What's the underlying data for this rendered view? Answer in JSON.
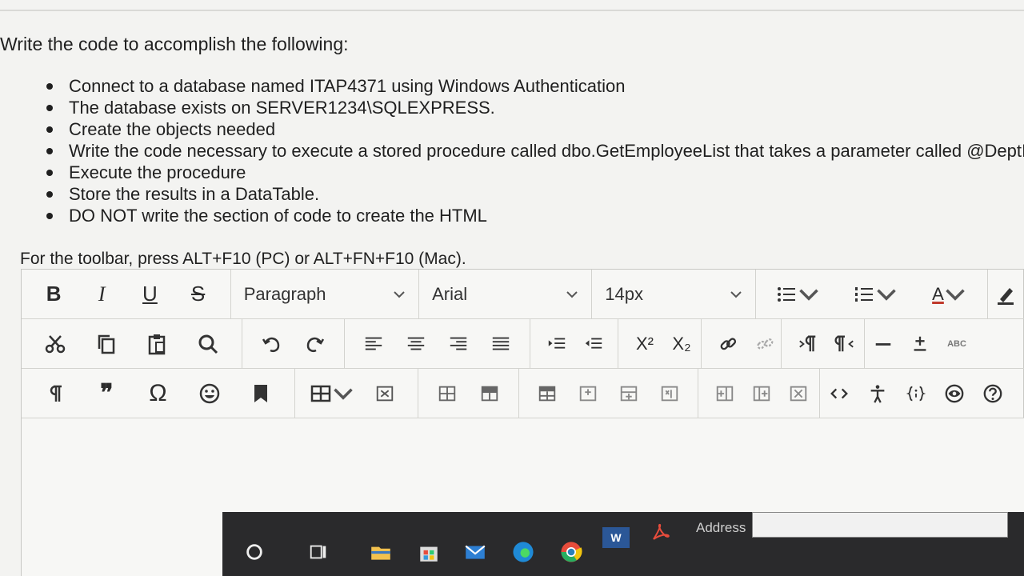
{
  "prompt": "Write the code to accomplish the following:",
  "bullets": [
    "Connect to a database named ITAP4371 using Windows Authentication",
    "The database exists on SERVER1234\\SQLEXPRESS.",
    "Create the objects needed",
    "Write the code necessary to execute a stored procedure called dbo.GetEmployeeList that takes a parameter called @DeptID",
    "Execute the procedure",
    "Store the results in a DataTable.",
    "DO NOT write the section of code to create the HTML"
  ],
  "toolbar_hint": "For the toolbar, press ALT+F10 (PC) or ALT+FN+F10 (Mac).",
  "toolbar": {
    "bold": "B",
    "italic": "I",
    "underline": "U",
    "strike": "S",
    "block_format": "Paragraph",
    "font_family": "Arial",
    "font_size": "14px",
    "font_color": "A",
    "superscript": "X²",
    "subscript": "X₂",
    "spell": "ABC",
    "omega": "Ω",
    "quote": "❞"
  },
  "taskbar": {
    "address_label": "Address",
    "word_letter": "W"
  },
  "colors": {
    "accent_red": "#c0392b",
    "taskbar_bg": "#2a2a2c"
  }
}
